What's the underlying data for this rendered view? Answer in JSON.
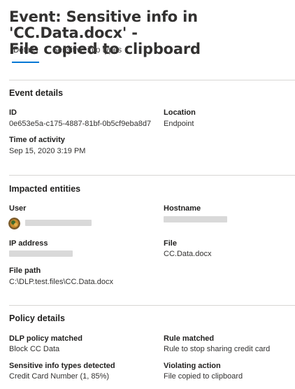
{
  "header": {
    "title_line1": "Event: Sensitive info in 'CC.Data.docx' -",
    "title_line2": "File copied to clipboard"
  },
  "tabs": [
    {
      "label": "Details",
      "active": true
    },
    {
      "label": "Sensitive info types",
      "active": false
    }
  ],
  "accent_color": "#0078d4",
  "event_details": {
    "title": "Event details",
    "id_label": "ID",
    "id_value": "0e653e5a-c175-4887-81bf-0b5cf9eba8d7",
    "location_label": "Location",
    "location_value": "Endpoint",
    "time_label": "Time of activity",
    "time_value": "Sep 15, 2020 3:19 PM"
  },
  "impacted_entities": {
    "title": "Impacted entities",
    "user_label": "User",
    "hostname_label": "Hostname",
    "ip_label": "IP address",
    "file_label": "File",
    "file_value": "CC.Data.docx",
    "path_label": "File path",
    "path_value": "C:\\DLP.test.files\\CC.Data.docx"
  },
  "policy_details": {
    "title": "Policy details",
    "dlp_label": "DLP policy matched",
    "dlp_value": "Block CC Data",
    "rule_label": "Rule matched",
    "rule_value": "Rule to stop sharing credit card",
    "types_label": "Sensitive info types detected",
    "types_value": "Credit Card Number (1, 85%)",
    "action_label": "Violating action",
    "action_value": "File copied to clipboard"
  }
}
